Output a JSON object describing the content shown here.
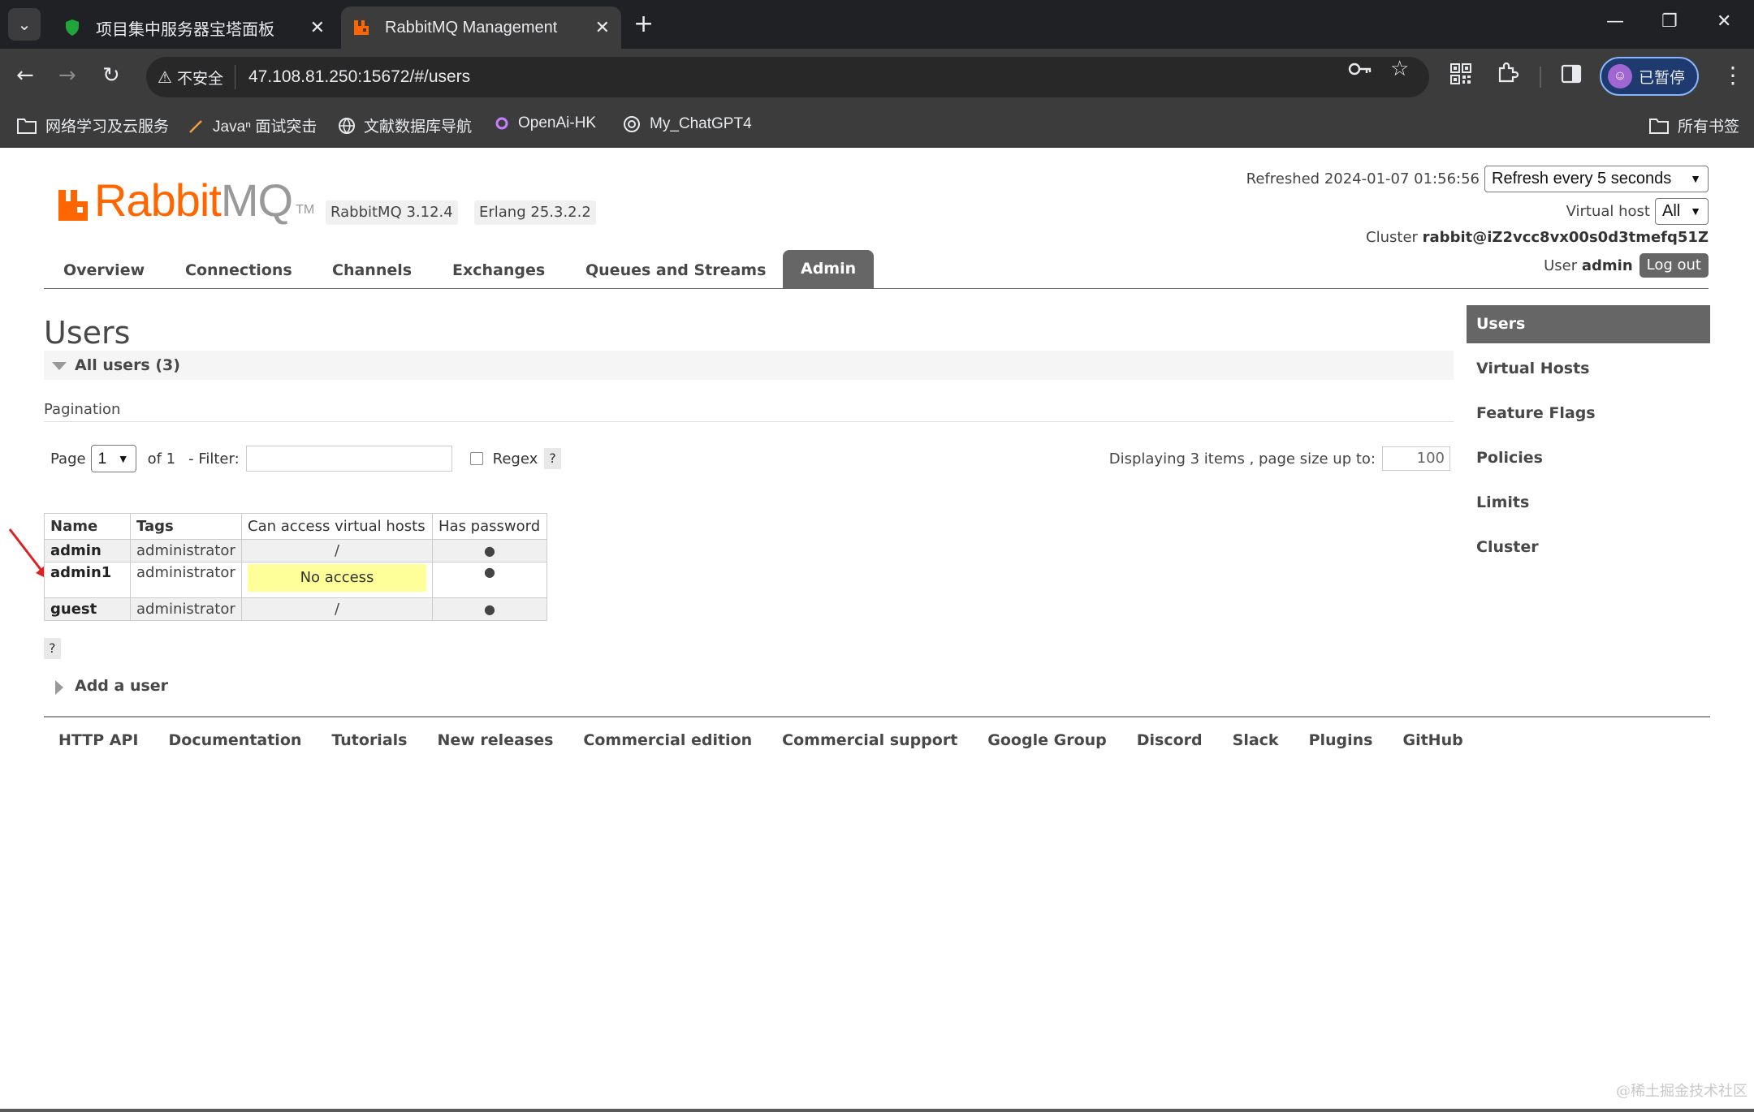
{
  "browser": {
    "tabs": [
      {
        "title": "项目集中服务器宝塔面板",
        "active": false
      },
      {
        "title": "RabbitMQ Management",
        "active": true
      }
    ],
    "address": {
      "security_label": "不安全",
      "url": "47.108.81.250:15672/#/users"
    },
    "profile_label": "已暂停",
    "bookmarks": [
      {
        "label": "网络学习及云服务",
        "icon": "folder-icon"
      },
      {
        "label": "Javaⁿ 面试突击",
        "icon": "pen-icon"
      },
      {
        "label": "文献数据库导航",
        "icon": "globe-icon"
      },
      {
        "label": "OpenAi-HK",
        "icon": "openai-icon"
      },
      {
        "label": "My_ChatGPT4",
        "icon": "openai-icon"
      }
    ],
    "all_bookmarks_label": "所有书签"
  },
  "header": {
    "logo_rabbit": "Rabbit",
    "logo_mq": "MQ",
    "logo_tm": "TM",
    "rabbitmq_version": "RabbitMQ 3.12.4",
    "erlang_version": "Erlang 25.3.2.2",
    "refreshed_label": "Refreshed 2024-01-07 01:56:56",
    "refresh_select": "Refresh every 5 seconds",
    "vhost_label": "Virtual host",
    "vhost_select": "All",
    "cluster_label": "Cluster",
    "cluster_name": "rabbit@iZ2vcc8vx00s0d3tmefq51Z",
    "user_label": "User",
    "user_name": "admin",
    "logout_label": "Log out"
  },
  "nav": [
    "Overview",
    "Connections",
    "Channels",
    "Exchanges",
    "Queues and Streams",
    "Admin"
  ],
  "main": {
    "title": "Users",
    "section_title": "All users (3)",
    "pagination_label": "Pagination",
    "page_label": "Page",
    "page_value": "1",
    "of_label": "of 1",
    "filter_label": "- Filter:",
    "regex_label": "Regex",
    "help_label": "?",
    "displaying_label": "Displaying 3 items , page size up to:",
    "page_size": "100",
    "table": {
      "headers": [
        "Name",
        "Tags",
        "Can access virtual hosts",
        "Has password"
      ],
      "rows": [
        {
          "name": "admin",
          "tags": "administrator",
          "vhosts": "/",
          "password": "●"
        },
        {
          "name": "admin1",
          "tags": "administrator",
          "vhosts": "No access",
          "password": "●"
        },
        {
          "name": "guest",
          "tags": "administrator",
          "vhosts": "/",
          "password": "●"
        }
      ]
    },
    "add_user_label": "Add a user"
  },
  "sidebar": [
    "Users",
    "Virtual Hosts",
    "Feature Flags",
    "Policies",
    "Limits",
    "Cluster"
  ],
  "footer": [
    "HTTP API",
    "Documentation",
    "Tutorials",
    "New releases",
    "Commercial edition",
    "Commercial support",
    "Google Group",
    "Discord",
    "Slack",
    "Plugins",
    "GitHub"
  ],
  "watermark": "@稀土掘金技术社区",
  "colors": {
    "brand_orange": "#ff6600",
    "nav_active": "#666666",
    "no_access_highlight": "#ffff99"
  }
}
